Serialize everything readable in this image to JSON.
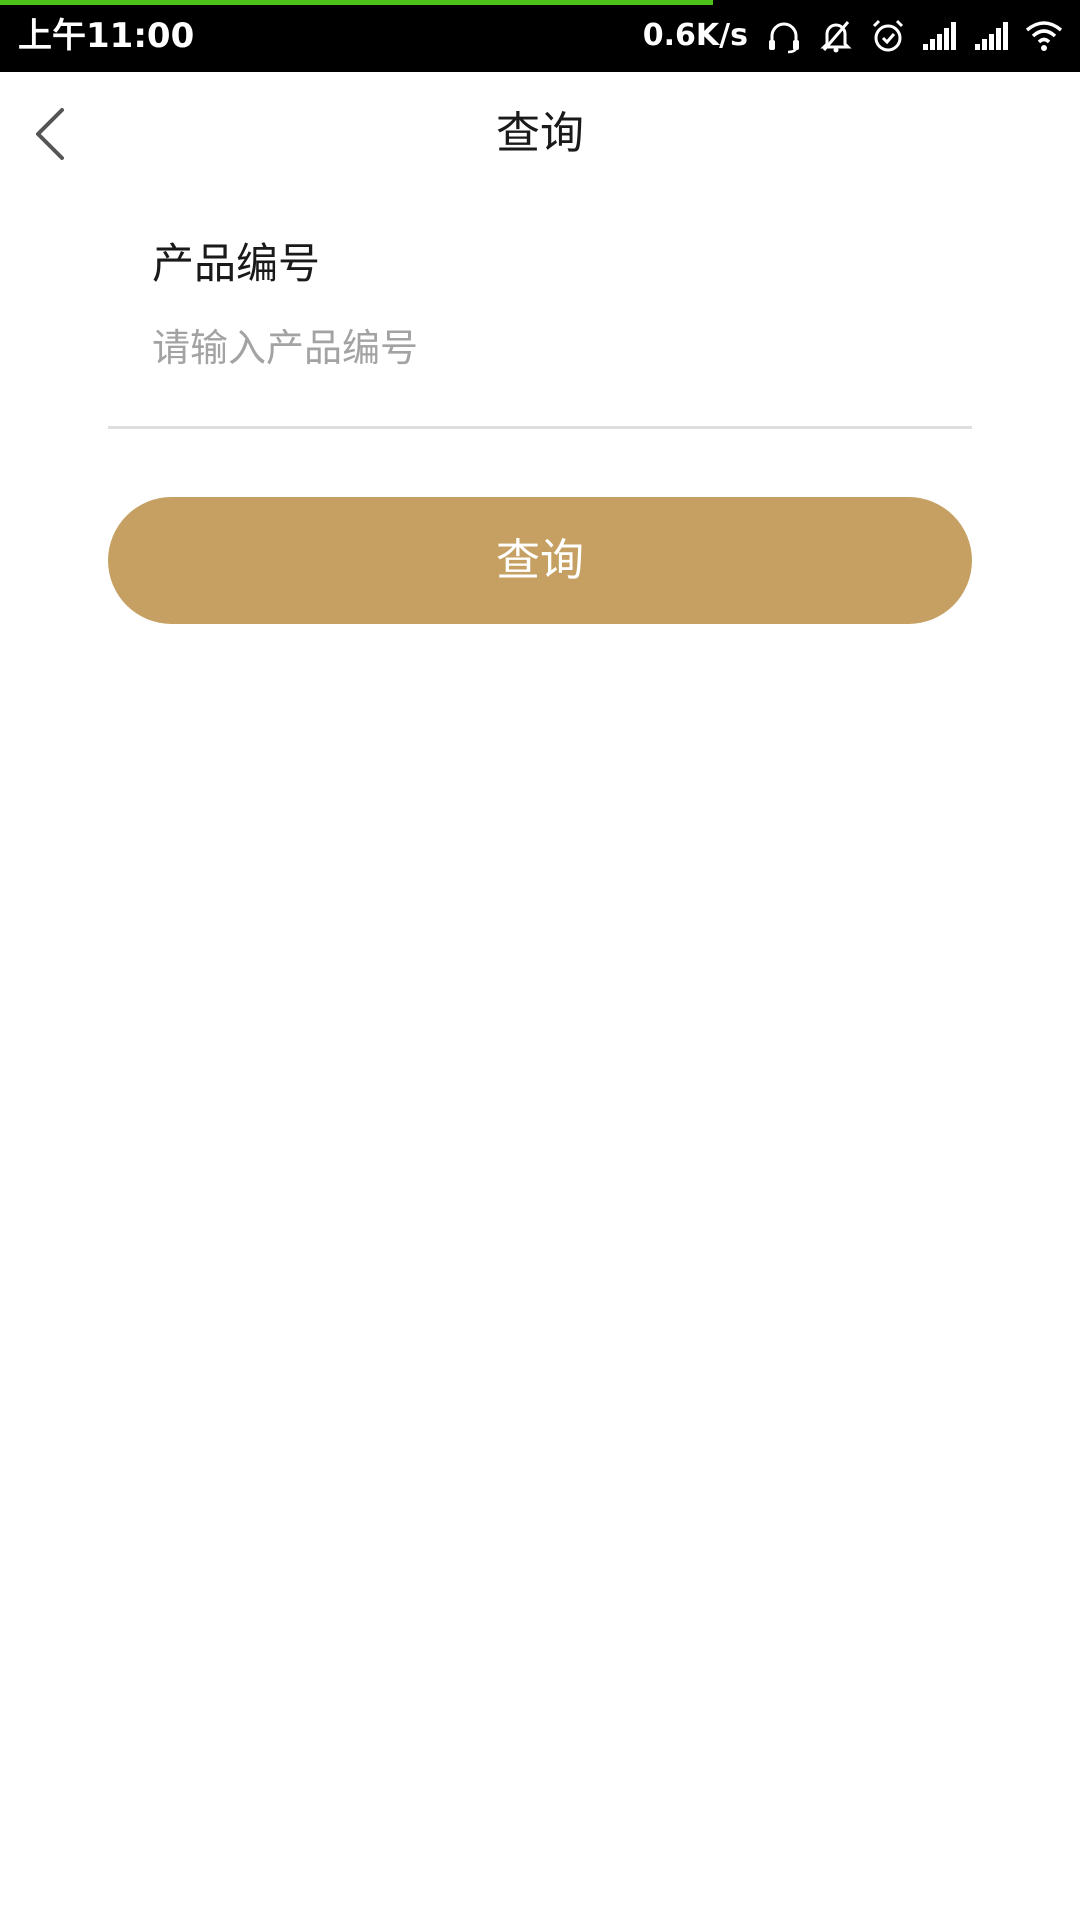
{
  "status_bar": {
    "time": "上午11:00",
    "net_speed": "0.6K/s",
    "page_load_progress": 0.66,
    "icons": [
      "headset-icon",
      "bell-muted-icon",
      "alarm-clock-icon",
      "signal-icon",
      "signal-icon",
      "wifi-icon"
    ]
  },
  "nav": {
    "title": "查询",
    "back_icon": "chevron-left-icon"
  },
  "form": {
    "product_no_label": "产品编号",
    "product_no_value": "",
    "product_no_placeholder": "请输入产品编号",
    "submit_label": "查询"
  },
  "colors": {
    "accent": "#c6a063",
    "progress": "#4cc21b",
    "status_bar_bg": "#000000",
    "placeholder": "#a3a3a3",
    "divider": "#dedede"
  }
}
